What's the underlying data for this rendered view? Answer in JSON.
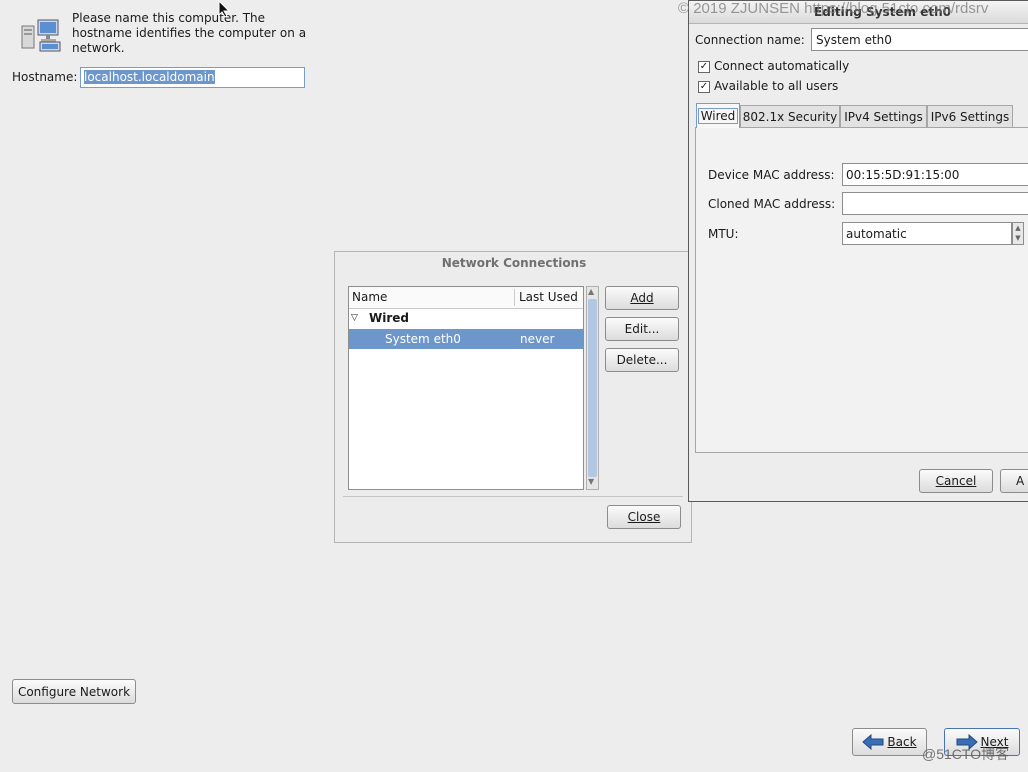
{
  "hostname_page": {
    "intro": "Please name this computer.  The hostname identifies the computer on a network.",
    "hostname_label": "Hostname:",
    "hostname_value": "localhost.localdomain",
    "configure_network": "Configure Network"
  },
  "nav": {
    "back": "Back",
    "next": "Next"
  },
  "network_connections": {
    "title": "Network Connections",
    "columns": [
      "Name",
      "Last Used"
    ],
    "group": "Wired",
    "rows": [
      {
        "name": "System eth0",
        "last_used": "never"
      }
    ],
    "buttons": {
      "add": "Add",
      "edit": "Edit...",
      "delete": "Delete...",
      "close": "Close"
    }
  },
  "editing_dialog": {
    "title": "Editing System eth0",
    "connection_name_label": "Connection name:",
    "connection_name_value": "System eth0",
    "connect_automatically": "Connect automatically",
    "available_to_all": "Available to all users",
    "tabs": [
      "Wired",
      "802.1x Security",
      "IPv4 Settings",
      "IPv6 Settings"
    ],
    "device_mac_label": "Device MAC address:",
    "device_mac_value": "00:15:5D:91:15:00",
    "cloned_mac_label": "Cloned MAC address:",
    "cloned_mac_value": "",
    "mtu_label": "MTU:",
    "mtu_value": "automatic",
    "cancel": "Cancel",
    "apply_partial": "A"
  },
  "watermarks": {
    "top": "© 2019 ZJUNSEN https://blog.51cto.com/rdsrv",
    "bottom": "@51CTO博客"
  },
  "colors": {
    "selection": "#6d97ca",
    "window_bg": "#ededed",
    "scroll_thumb": "#b3c7e3"
  }
}
